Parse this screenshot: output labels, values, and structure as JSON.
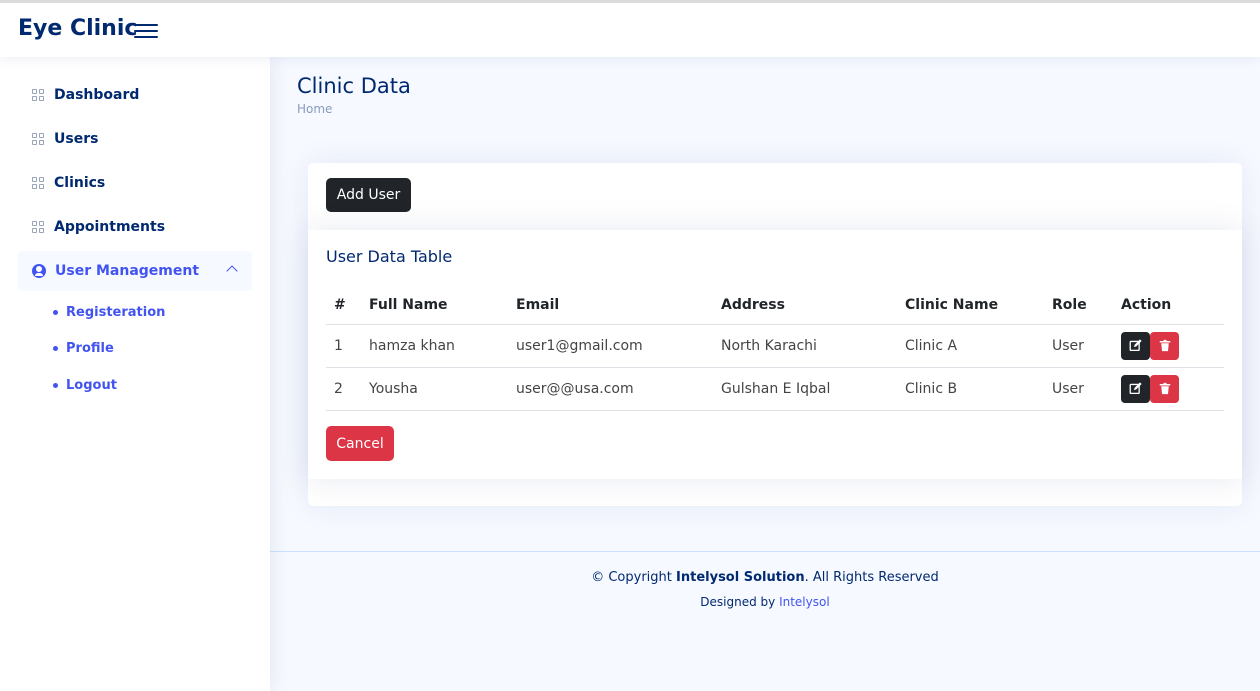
{
  "header": {
    "logo": "Eye Clinic"
  },
  "sidebar": {
    "items": [
      {
        "label": "Dashboard"
      },
      {
        "label": "Users"
      },
      {
        "label": "Clinics"
      },
      {
        "label": "Appointments"
      },
      {
        "label": "User Management"
      }
    ],
    "sub_items": [
      {
        "label": "Registeration"
      },
      {
        "label": "Profile"
      },
      {
        "label": "Logout"
      }
    ]
  },
  "page": {
    "title": "Clinic Data",
    "breadcrumb": "Home"
  },
  "card": {
    "add_button": "Add User",
    "table_title": "User Data Table",
    "cancel_button": "Cancel"
  },
  "table": {
    "headers": [
      "#",
      "Full Name",
      "Email",
      "Address",
      "Clinic Name",
      "Role",
      "Action"
    ],
    "rows": [
      {
        "id": "1",
        "name": "hamza khan",
        "email": "user1@gmail.com",
        "address": "North Karachi",
        "clinic": "Clinic A",
        "role": "User"
      },
      {
        "id": "2",
        "name": "Yousha",
        "email": "user@@usa.com",
        "address": "Gulshan E Iqbal",
        "clinic": "Clinic B",
        "role": "User"
      }
    ]
  },
  "footer": {
    "copyright_prefix": "© Copyright ",
    "company": "Intelysol Solution",
    "copyright_suffix": ". All Rights Reserved",
    "designed_by": "Designed by ",
    "designer": "Intelysol"
  },
  "colors": {
    "primary": "#4154f1",
    "navy": "#012970",
    "danger": "#dc3545",
    "dark": "#212529"
  }
}
